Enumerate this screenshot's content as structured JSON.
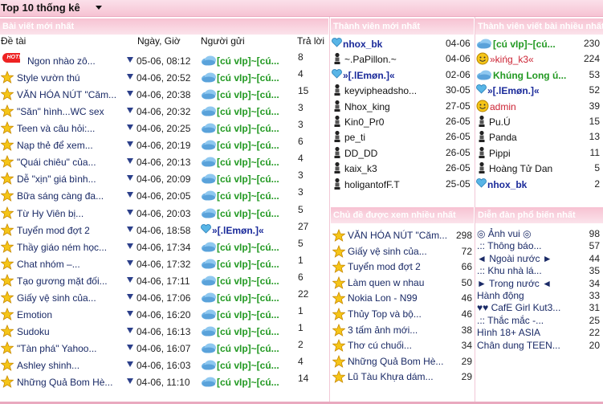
{
  "title": "Top 10 thống kê",
  "panels": {
    "latest_posts": "Bài viết mới nhất",
    "new_members": "Thành viên mới nhất",
    "top_posters": "Thành viên viết bài nhiều nhất",
    "most_viewed": "Chủ đề được xem nhiều nhất",
    "popular_forums": "Diễn đàn phổ biến nhất"
  },
  "headers": {
    "topic": "Đề tài",
    "date": "Ngày, Giờ",
    "sender": "Người gửi",
    "replies": "Trả lời"
  },
  "hot_label": "HOT!",
  "latest_posts": [
    {
      "title": "Ngon nhào zô...",
      "date": "05-06, 08:12",
      "sender": "[cú vIp]~[cú...",
      "replies": "8",
      "icon": "hot"
    },
    {
      "title": "Style vườn thú",
      "date": "04-06, 20:52",
      "sender": "[cú vIp]~[cú...",
      "replies": "4",
      "icon": "star"
    },
    {
      "title": "VĂN HÓA NÚT \"Căm...",
      "date": "04-06, 20:38",
      "sender": "[cú vIp]~[cú...",
      "replies": "15",
      "icon": "star"
    },
    {
      "title": "\"Săn\" hình...WC sex",
      "date": "04-06, 20:32",
      "sender": "[cú vIp]~[cú...",
      "replies": "3",
      "icon": "star"
    },
    {
      "title": "Teen và câu hỏi:...",
      "date": "04-06, 20:25",
      "sender": "[cú vIp]~[cú...",
      "replies": "3",
      "icon": "star"
    },
    {
      "title": "Nạp thẻ để xem...",
      "date": "04-06, 20:19",
      "sender": "[cú vIp]~[cú...",
      "replies": "6",
      "icon": "star"
    },
    {
      "title": "\"Quái chiêu\" của...",
      "date": "04-06, 20:13",
      "sender": "[cú vIp]~[cú...",
      "replies": "4",
      "icon": "star"
    },
    {
      "title": "Dễ \"xịn\" giá bình...",
      "date": "04-06, 20:09",
      "sender": "[cú vIp]~[cú...",
      "replies": "3",
      "icon": "star"
    },
    {
      "title": "Bữa sáng càng đa...",
      "date": "04-06, 20:05",
      "sender": "[cú vIp]~[cú...",
      "replies": "3",
      "icon": "star"
    },
    {
      "title": "Từ Hy Viên bị...",
      "date": "04-06, 20:03",
      "sender": "[cú vIp]~[cú...",
      "replies": "5",
      "icon": "star"
    },
    {
      "title": "Tuyển mod đợt 2",
      "date": "04-06, 18:58",
      "sender": "»[.lEmøn.]«",
      "replies": "27",
      "icon": "star",
      "sender_style": "blue"
    },
    {
      "title": "Thầy giáo ném học...",
      "date": "04-06, 17:34",
      "sender": "[cú vIp]~[cú...",
      "replies": "5",
      "icon": "star"
    },
    {
      "title": "Chat nhóm –...",
      "date": "04-06, 17:32",
      "sender": "[cú vIp]~[cú...",
      "replies": "1",
      "icon": "star"
    },
    {
      "title": "Tạo gương mặt đối...",
      "date": "04-06, 17:11",
      "sender": "[cú vIp]~[cú...",
      "replies": "6",
      "icon": "star"
    },
    {
      "title": "Giấy vệ sinh của...",
      "date": "04-06, 17:06",
      "sender": "[cú vIp]~[cú...",
      "replies": "22",
      "icon": "star"
    },
    {
      "title": "Emotion",
      "date": "04-06, 16:20",
      "sender": "[cú vIp]~[cú...",
      "replies": "1",
      "icon": "star"
    },
    {
      "title": "Sudoku",
      "date": "04-06, 16:13",
      "sender": "[cú vIp]~[cú...",
      "replies": "1",
      "icon": "star"
    },
    {
      "title": "\"Tàn phá\" Yahoo...",
      "date": "04-06, 16:07",
      "sender": "[cú vIp]~[cú...",
      "replies": "2",
      "icon": "star"
    },
    {
      "title": "Ashley shinh...",
      "date": "04-06, 16:03",
      "sender": "[cú vIp]~[cú...",
      "replies": "4",
      "icon": "star"
    },
    {
      "title": "Những Quả Bom Hè...",
      "date": "04-06, 11:10",
      "sender": "[cú vIp]~[cú...",
      "replies": "14",
      "icon": "star"
    }
  ],
  "new_members": [
    {
      "name": "nhox_bk",
      "date": "04-06",
      "icon": "heart",
      "style": "blue"
    },
    {
      "name": "~.PaPillon.~",
      "date": "04-06",
      "icon": "lady",
      "style": "plain"
    },
    {
      "name": "»[.lEmøn.]«",
      "date": "02-06",
      "icon": "heart",
      "style": "blue"
    },
    {
      "name": "keyvipheadsho...",
      "date": "30-05",
      "icon": "lady",
      "style": "plain"
    },
    {
      "name": "Nhox_king",
      "date": "27-05",
      "icon": "lady",
      "style": "plain"
    },
    {
      "name": "Kin0_Pr0",
      "date": "26-05",
      "icon": "lady",
      "style": "plain"
    },
    {
      "name": "pe_ti",
      "date": "26-05",
      "icon": "lady",
      "style": "plain"
    },
    {
      "name": "DD_DD",
      "date": "26-05",
      "icon": "lady",
      "style": "plain"
    },
    {
      "name": "kaix_k3",
      "date": "26-05",
      "icon": "lady",
      "style": "plain"
    },
    {
      "name": "holigantofF.T",
      "date": "25-05",
      "icon": "lady",
      "style": "plain"
    }
  ],
  "top_posters": [
    {
      "name": "[cú vIp]~[cú...",
      "count": "230",
      "icon": "cloud",
      "style": "vip"
    },
    {
      "name": "»kińg_k3«",
      "count": "224",
      "icon": "smile",
      "style": "red"
    },
    {
      "name": "Khúng Long ú...",
      "count": "53",
      "icon": "cloud",
      "style": "vip"
    },
    {
      "name": "»[.lEmøn.]«",
      "count": "52",
      "icon": "heart",
      "style": "blue"
    },
    {
      "name": "admin",
      "count": "39",
      "icon": "smile",
      "style": "red"
    },
    {
      "name": "Pu.Ú",
      "count": "15",
      "icon": "lady",
      "style": "plain"
    },
    {
      "name": "Panda",
      "count": "13",
      "icon": "lady",
      "style": "plain"
    },
    {
      "name": "Pippi",
      "count": "11",
      "icon": "lady",
      "style": "plain"
    },
    {
      "name": "Hoàng Tử Dan",
      "count": "5",
      "icon": "lady",
      "style": "plain"
    },
    {
      "name": "nhox_bk",
      "count": "2",
      "icon": "heart",
      "style": "blue"
    }
  ],
  "most_viewed": [
    {
      "title": "VĂN HÓA NÚT \"Căm...",
      "views": "298"
    },
    {
      "title": "Giấy vệ sinh của...",
      "views": "72"
    },
    {
      "title": "Tuyển mod đợt 2",
      "views": "66"
    },
    {
      "title": "Làm quen w nhau",
      "views": "50"
    },
    {
      "title": "Nokia Lon - N99",
      "views": "46"
    },
    {
      "title": "Thủy Top và bộ...",
      "views": "46"
    },
    {
      "title": "3 tấm ảnh mới...",
      "views": "38"
    },
    {
      "title": "Thơ cú chuối...",
      "views": "34"
    },
    {
      "title": "Những Quả Bom Hè...",
      "views": "29"
    },
    {
      "title": "Lũ Tàu Khựa dám...",
      "views": "29"
    }
  ],
  "popular_forums": [
    {
      "name": "◎ Ảnh vui ◎",
      "count": "98"
    },
    {
      "name": ".:: Thông báo...",
      "count": "57"
    },
    {
      "name": "◄ Ngoài nước ►",
      "count": "44"
    },
    {
      "name": ".:: Khu nhà lá...",
      "count": "35"
    },
    {
      "name": "► Trong nước ◄",
      "count": "34"
    },
    {
      "name": "Hành động",
      "count": "33"
    },
    {
      "name": "♥♥ CafE Girl Kut3...",
      "count": "31"
    },
    {
      "name": ".:: Thắc mắc -...",
      "count": "25"
    },
    {
      "name": "Hình 18+ ASIA",
      "count": "22"
    },
    {
      "name": "Chân dung TEEN...",
      "count": "20"
    }
  ],
  "colors": {
    "header_pink": "#f7c2d2",
    "link_blue": "#1a2a66",
    "vip_green": "#229922",
    "name_blue": "#1a2a9a",
    "admin_red": "#cc2233"
  }
}
